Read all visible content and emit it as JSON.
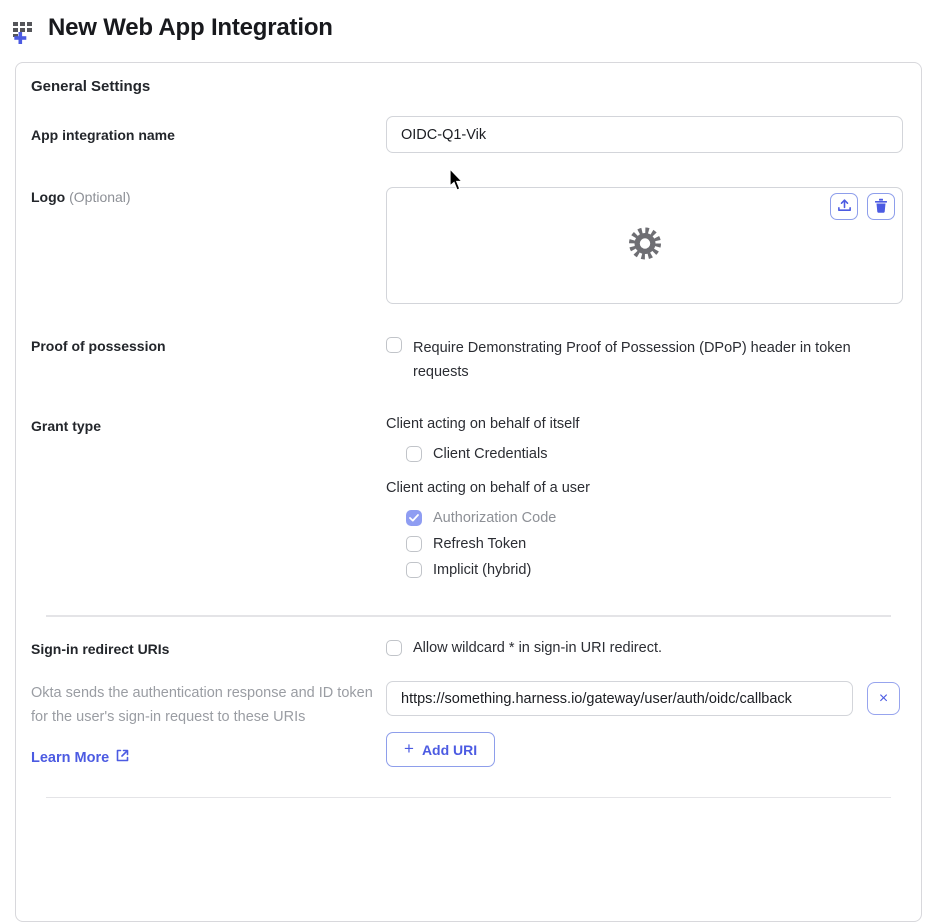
{
  "page": {
    "title": "New Web App Integration"
  },
  "colors": {
    "accent_blue": "#4c5be2",
    "accent_blue_light_border": "#97a4ee",
    "checked_checkbox_fill": "#8f9df2",
    "muted_text": "#8d9096",
    "border_gray": "#d3d5da",
    "gear_gray": "#6e6e73"
  },
  "card": {
    "section_title": "General Settings",
    "app_name": {
      "label": "App integration name",
      "value": "OIDC-Q1-Vik"
    },
    "logo": {
      "label": "Logo",
      "optional": "(Optional)",
      "icons": [
        "upload-icon",
        "trash-icon",
        "gear-icon"
      ]
    },
    "dpop": {
      "label": "Proof of possession",
      "checkbox_label": "Require Demonstrating Proof of Possession (DPoP) header in token requests",
      "checked": false
    },
    "grant_type": {
      "label": "Grant type",
      "self_heading": "Client acting on behalf of itself",
      "self_options": [
        {
          "label": "Client Credentials",
          "checked": false,
          "disabled": false
        }
      ],
      "user_heading": "Client acting on behalf of a user",
      "user_options": [
        {
          "label": "Authorization Code",
          "checked": true,
          "disabled": true
        },
        {
          "label": "Refresh Token",
          "checked": false,
          "disabled": false
        },
        {
          "label": "Implicit (hybrid)",
          "checked": false,
          "disabled": false
        }
      ]
    },
    "redirect": {
      "label": "Sign-in redirect URIs",
      "wildcard_label": "Allow wildcard * in sign-in URI redirect.",
      "wildcard_checked": false,
      "helper": "Okta sends the authentication response and ID token for the user's sign-in request to these URIs",
      "learn_more_label": "Learn More",
      "uri_value": "https://something.harness.io/gateway/user/auth/oidc/callback",
      "remove_uri_label": "×",
      "add_uri_label": "Add URI",
      "add_uri_plus": "+"
    }
  }
}
